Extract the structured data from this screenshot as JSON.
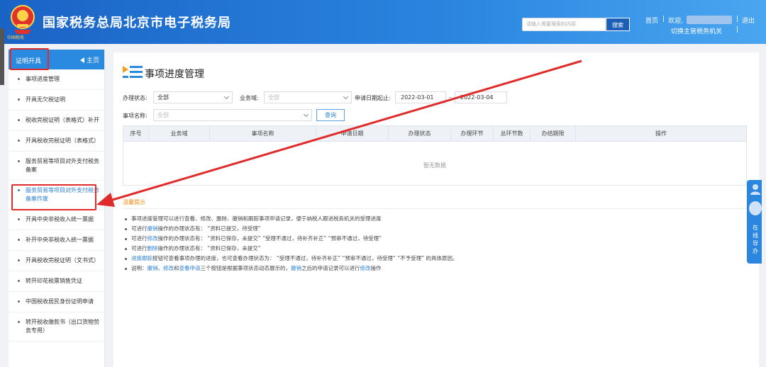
{
  "header": {
    "title": "国家税务总局北京市电子税务局",
    "emblem_text": "中国税务",
    "search_placeholder": "请输入需要搜索的内容",
    "search_label": "搜索",
    "home_link": "首页",
    "welcome": "欢迎,",
    "logout": "退出",
    "switch_org": "切换主管税务机关",
    "separator": "|"
  },
  "sidebar": {
    "section_label": "证明开具",
    "home_label": "主页",
    "items": [
      {
        "label": "事项进度管理"
      },
      {
        "label": "开具无欠税证明"
      },
      {
        "label": "税收完税证明（表格式）补开"
      },
      {
        "label": "开具税收完税证明（表格式）"
      },
      {
        "label": "服务贸易等项目对外支付税务备案"
      },
      {
        "label": "服务贸易等项目对外支付税务备案作废"
      },
      {
        "label": "开具中央非税收入统一票据"
      },
      {
        "label": "补开中央非税收入统一票据"
      },
      {
        "label": "开具税收完税证明（文书式）"
      },
      {
        "label": "转开印花税票销售凭证"
      },
      {
        "label": "中国税收居民身份证明申请"
      },
      {
        "label": "转开税收缴款书（出口货物劳务专用）"
      }
    ]
  },
  "main": {
    "page_title": "事项进度管理",
    "filters": {
      "status_label": "办理状态:",
      "status_value": "全部",
      "domain_label": "业务域:",
      "domain_value": "全部",
      "date_label": "申请日期起止:",
      "date_from": "2022-03-01",
      "date_sep": "-",
      "date_to": "2022-03-04",
      "item_label": "事项名称:",
      "item_value": "全部",
      "query_label": "查询"
    },
    "table": {
      "columns": [
        "序号",
        "业务域",
        "事项名称",
        "申请日期",
        "办理状态",
        "办理环节",
        "总环节数",
        "办结期限",
        "操作"
      ],
      "empty_text": "暂无数据"
    },
    "hints": {
      "title": "温馨提示",
      "lines": [
        {
          "parts": [
            {
              "t": "事项进度管理可以进行查看、修改、删除、撤销和跟踪事项申请记录，便于纳税人跟进税务机关的受理进度"
            }
          ]
        },
        {
          "parts": [
            {
              "t": "可进行"
            },
            {
              "t": "撤销",
              "hl": true
            },
            {
              "t": "操作的办理状态有：  “资料已提交，待受理”"
            }
          ]
        },
        {
          "parts": [
            {
              "t": "可进行"
            },
            {
              "t": "修改",
              "hl": true
            },
            {
              "t": "操作的办理状态有：  “资料已保存，未提交”   “受理不通过，待补齐补正”   “预审不通过，待受理”"
            }
          ]
        },
        {
          "parts": [
            {
              "t": "可进行"
            },
            {
              "t": "删除",
              "hl": true
            },
            {
              "t": "操作的办理状态有：  “资料已保存，未提交”"
            }
          ]
        },
        {
          "parts": [
            {
              "t": "进度跟踪",
              "hl": true
            },
            {
              "t": "按钮可查看事项办理的进度，也可查看办理状态为：  “受理不通过，待补齐补正”   “预审不通过，待受理”   “不予受理”  的具体原因。"
            }
          ]
        },
        {
          "parts": [
            {
              "t": "说明："
            },
            {
              "t": "撤销",
              "hl": true
            },
            {
              "t": "、"
            },
            {
              "t": "修改",
              "hl": true
            },
            {
              "t": "和"
            },
            {
              "t": "查看申请",
              "hl": true
            },
            {
              "t": "三个按钮是根据事项状态动态展示的，"
            },
            {
              "t": "撤销",
              "hl": true
            },
            {
              "t": "之后的申请记录可以进行"
            },
            {
              "t": "修改",
              "hl": true
            },
            {
              "t": "操作"
            }
          ]
        }
      ]
    }
  },
  "float_widget": {
    "label": "在线导办"
  },
  "colors": {
    "header_blue": "#2b86e0",
    "link_blue": "#2a7fd6",
    "annotation_red": "#e02b2b",
    "hint_orange": "#f08c16"
  }
}
